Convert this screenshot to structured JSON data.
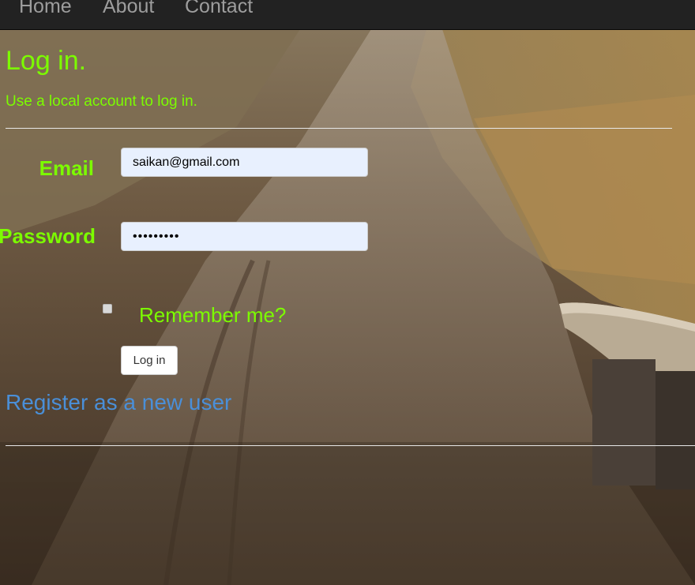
{
  "nav": {
    "home": "Home",
    "about": "About",
    "contact": "Contact"
  },
  "page": {
    "title": "Log in.",
    "subtitle": "Use a local account to log in."
  },
  "form": {
    "email_label": "Email",
    "email_value": "saikan@gmail.com",
    "password_label": "Password",
    "password_value": "•••••••••",
    "remember_label": "Remember me?",
    "remember_checked": false,
    "submit_label": "Log in"
  },
  "links": {
    "register": "Register as a new user"
  },
  "colors": {
    "accent": "#7cfc00",
    "link": "#4a8fd8",
    "navbar": "#222222",
    "input_bg": "#e8f0fe"
  }
}
